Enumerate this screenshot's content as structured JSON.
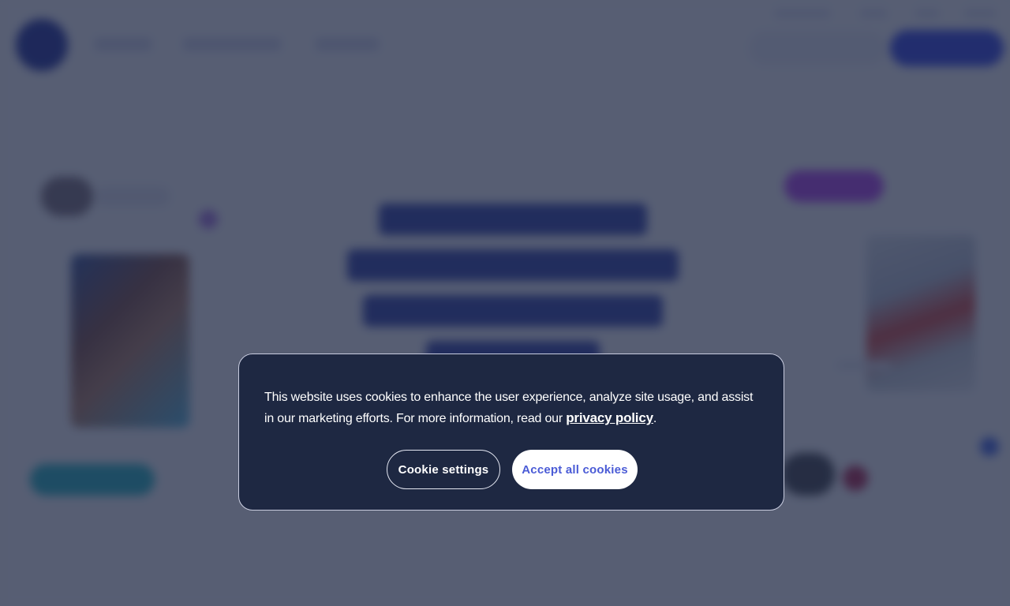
{
  "colors": {
    "overlay": "#1f2844",
    "dialog_bg": "#1e2842",
    "accent": "#4a5bd6",
    "brand": "#1b2a9c"
  },
  "cookie_banner": {
    "message": "This website uses cookies to enhance the user experience, analyze site usage, and assist in our marketing efforts. For more information, read our ",
    "policy_link": "privacy policy",
    "message_end": ".",
    "settings_button": "Cookie settings",
    "accept_button": "Accept all cookies"
  },
  "background_page": {
    "icons": [
      "logo-icon"
    ]
  }
}
